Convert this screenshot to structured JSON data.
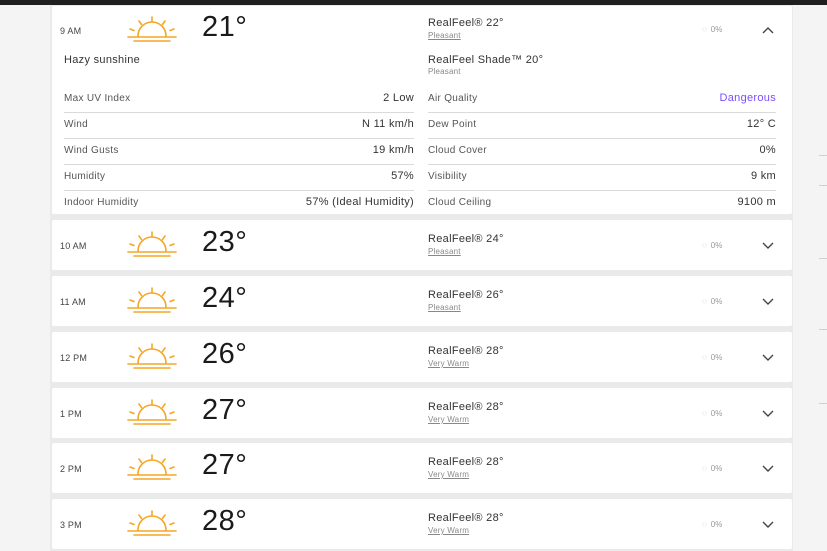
{
  "expanded": {
    "time": "9 AM",
    "icon": "hazy-sunshine-icon",
    "temp": "21°",
    "realfeel": "RealFeel® 22°",
    "realfeel_phrase": "Pleasant",
    "phrase": "Hazy sunshine",
    "realfeel_shade": "RealFeel Shade™ 20°",
    "realfeel_shade_phrase": "Pleasant",
    "precip": "0%",
    "left_details": [
      {
        "label": "Max UV Index",
        "value": "2 Low"
      },
      {
        "label": "Wind",
        "value": "N 11 km/h"
      },
      {
        "label": "Wind Gusts",
        "value": "19 km/h"
      },
      {
        "label": "Humidity",
        "value": "57%"
      },
      {
        "label": "Indoor Humidity",
        "value": "57% (Ideal Humidity)"
      }
    ],
    "right_details": [
      {
        "label": "Air Quality",
        "value": "Dangerous"
      },
      {
        "label": "Dew Point",
        "value": "12° C"
      },
      {
        "label": "Cloud Cover",
        "value": "0%"
      },
      {
        "label": "Visibility",
        "value": "9 km"
      },
      {
        "label": "Cloud Ceiling",
        "value": "9100 m"
      }
    ]
  },
  "hours": [
    {
      "time": "10 AM",
      "temp": "23°",
      "realfeel": "RealFeel® 24°",
      "phrase": "Pleasant",
      "precip": "0%"
    },
    {
      "time": "11 AM",
      "temp": "24°",
      "realfeel": "RealFeel® 26°",
      "phrase": "Pleasant",
      "precip": "0%"
    },
    {
      "time": "12 PM",
      "temp": "26°",
      "realfeel": "RealFeel® 28°",
      "phrase": "Very Warm",
      "precip": "0%"
    },
    {
      "time": "1 PM",
      "temp": "27°",
      "realfeel": "RealFeel® 28°",
      "phrase": "Very Warm",
      "precip": "0%"
    },
    {
      "time": "2 PM",
      "temp": "27°",
      "realfeel": "RealFeel® 28°",
      "phrase": "Very Warm",
      "precip": "0%"
    },
    {
      "time": "3 PM",
      "temp": "28°",
      "realfeel": "RealFeel® 28°",
      "phrase": "Very Warm",
      "precip": "0%"
    }
  ],
  "colors": {
    "sun": "#f5a623",
    "danger": "#7c4dff"
  }
}
